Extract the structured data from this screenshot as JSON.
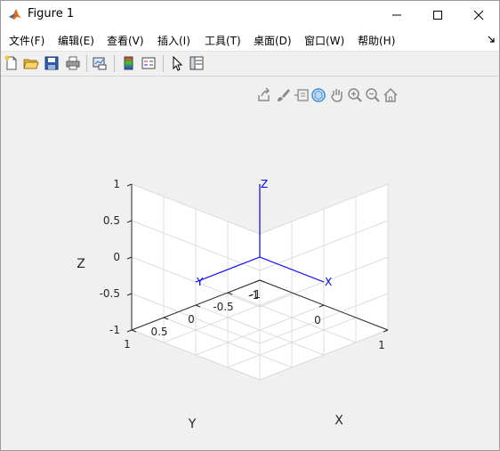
{
  "window": {
    "title": "Figure 1"
  },
  "menu": [
    {
      "label": "文件(F)"
    },
    {
      "label": "编辑(E)"
    },
    {
      "label": "查看(V)"
    },
    {
      "label": "插入(I)"
    },
    {
      "label": "工具(T)"
    },
    {
      "label": "桌面(D)"
    },
    {
      "label": "窗口(W)"
    },
    {
      "label": "帮助(H)"
    }
  ],
  "toolbar_icons": [
    "new-figure-icon",
    "open-file-icon",
    "save-icon",
    "print-icon",
    "link-plot-icon",
    "insert-colorbar-icon",
    "insert-legend-icon",
    "edit-plot-icon",
    "property-inspector-icon"
  ],
  "axes_toolbar_icons": [
    "export-icon",
    "brush-icon",
    "data-tips-icon",
    "rotate-3d-icon",
    "pan-icon",
    "zoom-in-icon",
    "zoom-out-icon",
    "home-icon"
  ],
  "chart_data": {
    "type": "line",
    "view": "3d",
    "xlabel": "X",
    "ylabel": "Y",
    "zlabel": "Z",
    "xlim": [
      -1,
      1
    ],
    "ylim": [
      -1,
      1
    ],
    "zlim": [
      -1,
      1
    ],
    "xticks": [
      "-1",
      "0",
      "1"
    ],
    "yticks": [
      "-1",
      "-0.5",
      "0",
      "0.5",
      "1"
    ],
    "zticks": [
      "-1",
      "-0.5",
      "0",
      "0.5",
      "1"
    ],
    "grid": true,
    "line_color": "#0000ff",
    "series": [
      {
        "name": "X",
        "points": [
          [
            0,
            0,
            0
          ],
          [
            1,
            0,
            0
          ]
        ]
      },
      {
        "name": "Y",
        "points": [
          [
            0,
            0,
            0
          ],
          [
            0,
            1,
            0
          ]
        ]
      },
      {
        "name": "Z",
        "points": [
          [
            0,
            0,
            0
          ],
          [
            0,
            0,
            1
          ]
        ]
      }
    ],
    "labels": [
      "X",
      "Y",
      "Z"
    ]
  }
}
